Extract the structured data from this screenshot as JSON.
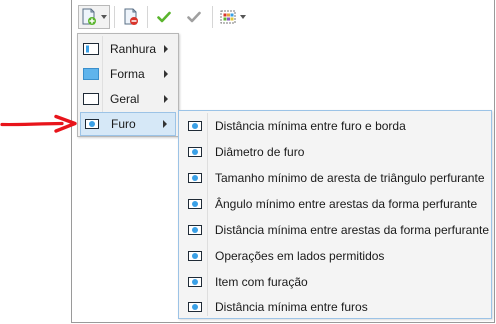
{
  "menu": {
    "items": [
      {
        "label": "Ranhura",
        "icon": "slot-icon"
      },
      {
        "label": "Forma",
        "icon": "shape-icon"
      },
      {
        "label": "Geral",
        "icon": "general-icon"
      },
      {
        "label": "Furo",
        "icon": "hole-icon",
        "active": true
      }
    ]
  },
  "submenu": {
    "items": [
      {
        "label": "Distância mínima entre furo e borda"
      },
      {
        "label": "Diâmetro de furo"
      },
      {
        "label": "Tamanho mínimo de aresta de triângulo perfurante"
      },
      {
        "label": "Ângulo mínimo entre arestas da forma perfurante"
      },
      {
        "label": "Distância mínima entre arestas da forma perfurante"
      },
      {
        "label": "Operações em lados permitidos"
      },
      {
        "label": "Item com furação"
      },
      {
        "label": "Distância mínima entre furos"
      }
    ]
  },
  "colors": {
    "accent": "#3aa0e6",
    "highlight": "#d6e8f7",
    "arrow": "#e8141b",
    "check_green": "#5ab52d"
  }
}
